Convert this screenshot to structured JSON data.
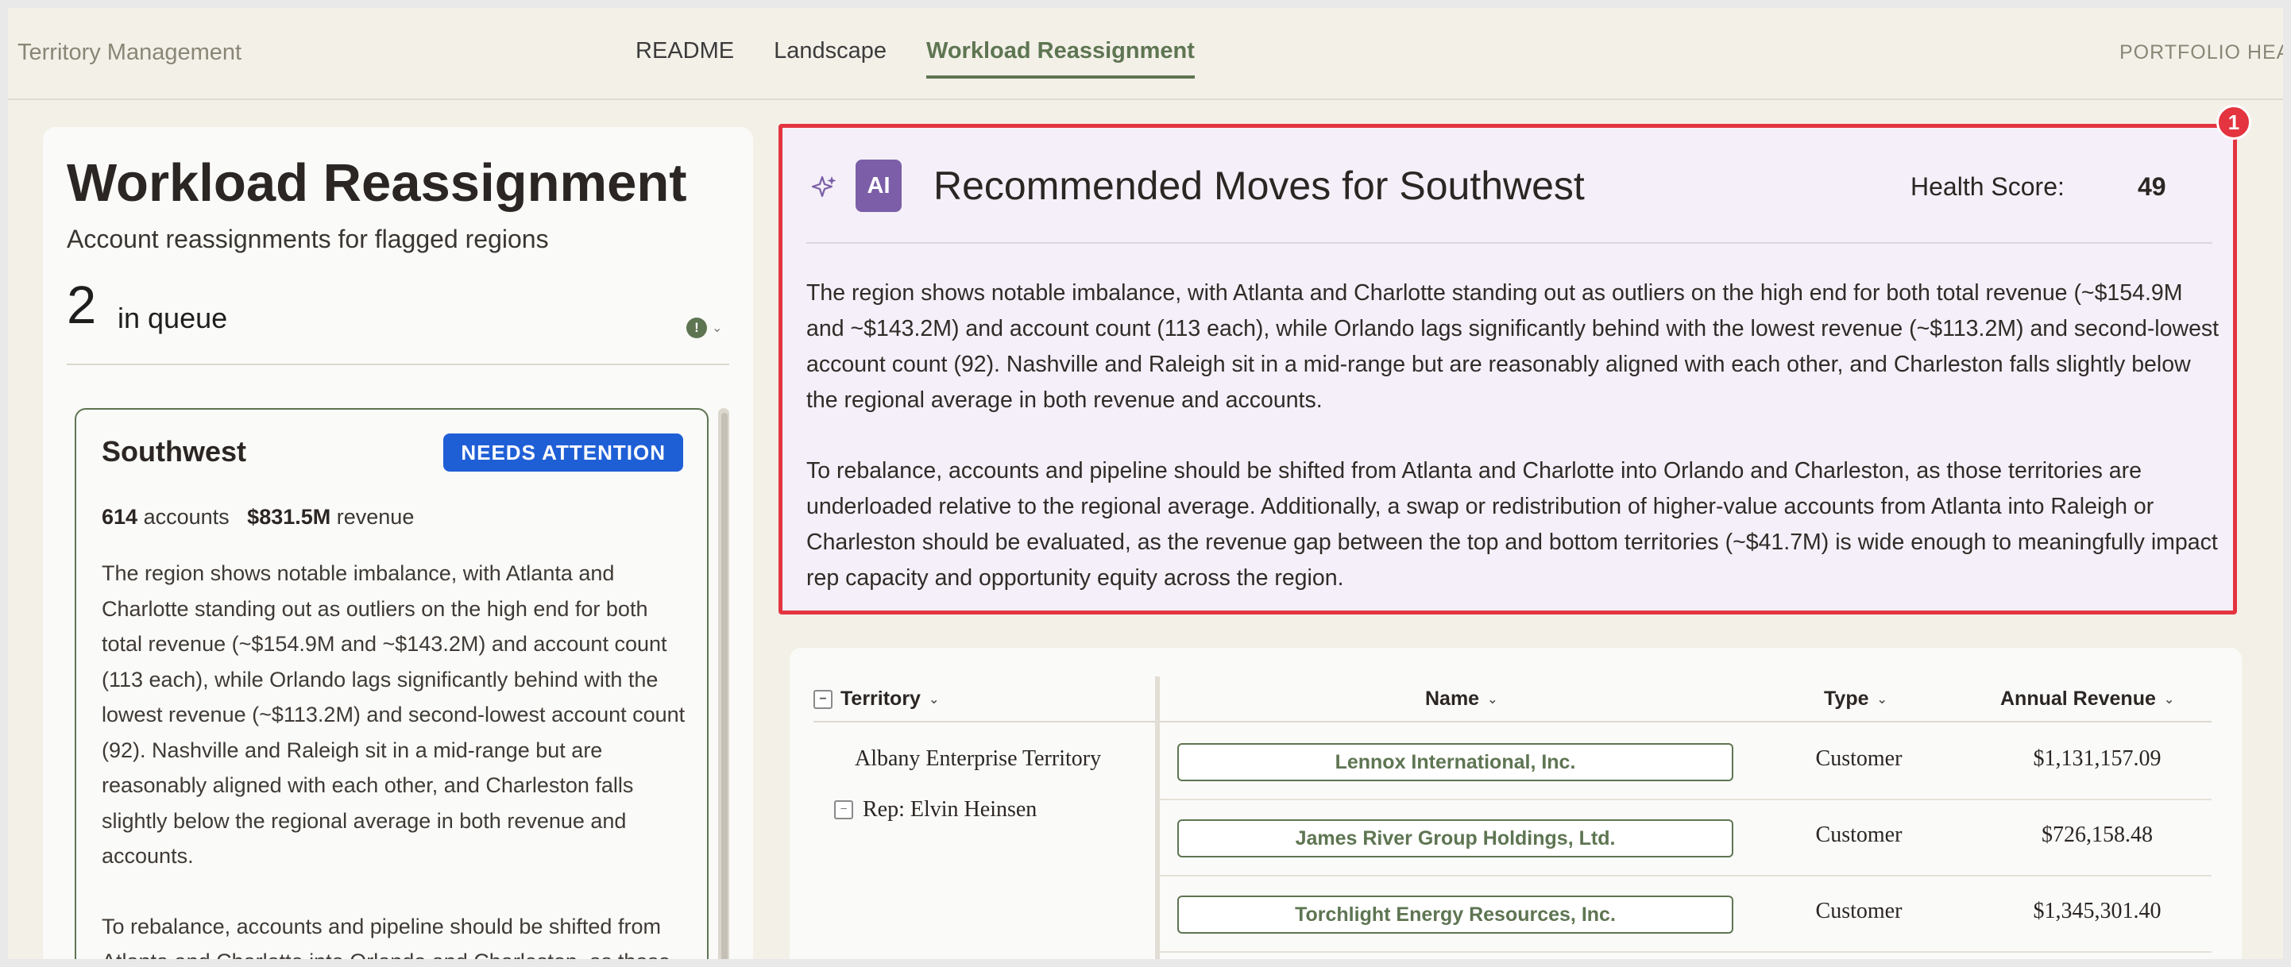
{
  "app": {
    "title": "Territory Management",
    "portfolio_label": "PORTFOLIO HEAL"
  },
  "nav": {
    "tabs": [
      {
        "label": "README"
      },
      {
        "label": "Landscape"
      },
      {
        "label": "Workload Reassignment",
        "active": true
      }
    ]
  },
  "left": {
    "title": "Workload Reassignment",
    "subtitle": "Account reassignments for flagged regions",
    "queue_count": "2",
    "queue_label": "in queue",
    "info_glyph": "!",
    "card": {
      "region": "Southwest",
      "badge": "NEEDS ATTENTION",
      "accounts_value": "614",
      "accounts_label": "accounts",
      "revenue_value": "$831.5M",
      "revenue_label": "revenue",
      "paragraph1": "The region shows notable imbalance, with Atlanta and Charlotte standing out as outliers on the high end for both total revenue (~$154.9M and ~$143.2M) and account count (113 each), while Orlando lags significantly behind with the lowest revenue (~$113.2M) and second-lowest account count (92). Nashville and Raleigh sit in a mid-range but are reasonably aligned with each other, and Charleston falls slightly below the regional average in both revenue and accounts.",
      "paragraph2": "To rebalance, accounts and pipeline should be shifted from Atlanta and Charlotte into Orlando and Charleston, as those"
    }
  },
  "ai": {
    "marker": "1",
    "badge": "AI",
    "title": "Recommended Moves for Southwest",
    "health_label": "Health Score:",
    "health_value": "49",
    "paragraph1": "The region shows notable imbalance, with Atlanta and Charlotte standing out as outliers on the high end for both total revenue (~$154.9M and ~$143.2M) and account count (113 each), while Orlando lags significantly behind with the lowest revenue (~$113.2M) and second-lowest account count (92). Nashville and Raleigh sit in a mid-range but are reasonably aligned with each other, and Charleston falls slightly below the regional average in both revenue and accounts.",
    "paragraph2": "To rebalance, accounts and pipeline should be shifted from Atlanta and Charlotte into Orlando and Charleston, as those territories are underloaded relative to the regional average. Additionally, a swap or redistribution of higher-value accounts from Atlanta into Raleigh or Charleston should be evaluated, as the revenue gap between the top and bottom territories (~$41.7M) is wide enough to meaningfully impact rep capacity and opportunity equity across the region."
  },
  "table": {
    "headers": {
      "territory": "Territory",
      "name": "Name",
      "type": "Type",
      "revenue": "Annual Revenue"
    },
    "collapse_glyph": "−",
    "tree": {
      "territory": "Albany Enterprise Territory",
      "rep": "Rep: Elvin Heinsen"
    },
    "rows": [
      {
        "name": "Lennox International, Inc.",
        "type": "Customer",
        "revenue": "$1,131,157.09"
      },
      {
        "name": "James River Group Holdings, Ltd.",
        "type": "Customer",
        "revenue": "$726,158.48"
      },
      {
        "name": "Torchlight Energy Resources, Inc.",
        "type": "Customer",
        "revenue": "$1,345,301.40"
      }
    ]
  }
}
